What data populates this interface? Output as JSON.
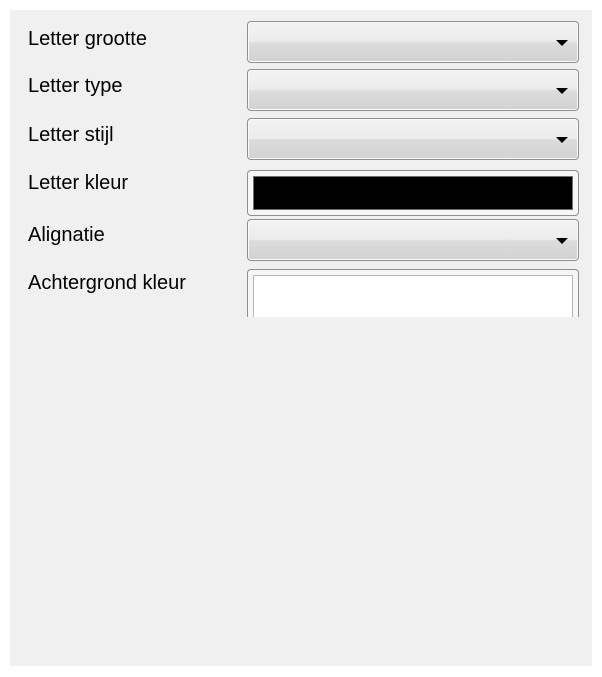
{
  "form": {
    "font_size": {
      "label": "Letter grootte",
      "value": ""
    },
    "font_type": {
      "label": "Letter type",
      "value": ""
    },
    "font_style": {
      "label": "Letter stijl",
      "value": ""
    },
    "font_color": {
      "label": "Letter kleur",
      "color": "#000000"
    },
    "alignment": {
      "label": "Alignatie",
      "value": ""
    },
    "background_color": {
      "label": "Achtergrond kleur",
      "color": "#ffffff"
    }
  },
  "icons": {
    "dropdown": "chevron-down-icon"
  },
  "colors": {
    "panel_background": "#f0f0f0",
    "page_background": "#ffffff"
  }
}
